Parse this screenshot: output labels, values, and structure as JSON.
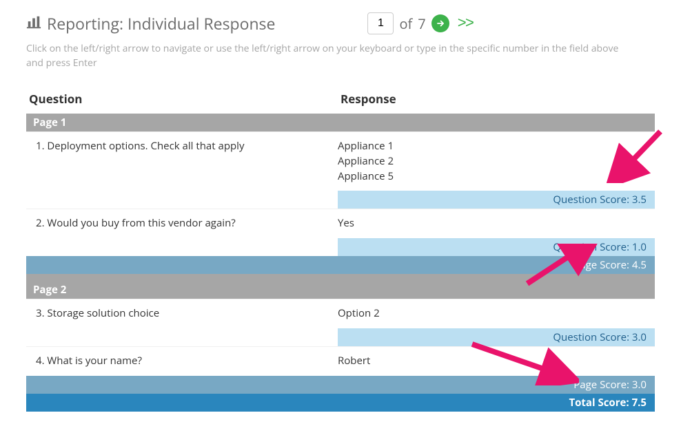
{
  "title": "Reporting: Individual Response",
  "nav": {
    "current": "1",
    "of_label": "of",
    "total": "7",
    "next_double": ">>"
  },
  "help": "Click on the left/right arrow to navigate or use the left/right arrow on your keyboard or type in the specific number in the field above and press Enter",
  "columns": {
    "question": "Question",
    "response": "Response"
  },
  "labels": {
    "question_score": "Question Score:",
    "page_score": "Page Score:",
    "total_score": "Total Score:"
  },
  "pages": [
    {
      "label": "Page 1",
      "items": [
        {
          "q": "1. Deployment options.  Check all that apply",
          "r": [
            "Appliance 1",
            "Appliance 2",
            "Appliance 5"
          ],
          "score": "3.5"
        },
        {
          "q": "2. Would you buy from this vendor again?",
          "r": [
            "Yes"
          ],
          "score": "1.0"
        }
      ],
      "page_score": "4.5"
    },
    {
      "label": "Page 2",
      "items": [
        {
          "q": "3. Storage solution choice",
          "r": [
            "Option 2"
          ],
          "score": "3.0"
        },
        {
          "q": "4. What is your name?",
          "r": [
            "Robert"
          ],
          "score": null
        }
      ],
      "page_score": "3.0"
    }
  ],
  "total_score": "7.5"
}
